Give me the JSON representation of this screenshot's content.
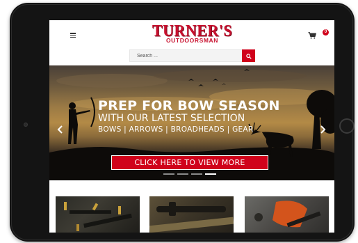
{
  "header": {
    "logo_top": "TURNER'S",
    "logo_bottom": "OUTDOORSMAN",
    "cart_count": "0"
  },
  "search": {
    "placeholder": "Search ..."
  },
  "hero": {
    "headline": "PREP FOR BOW SEASON",
    "subline": "WITH OUR LATEST SELECTION",
    "categories": "BOWS | ARROWS | BROADHEADS | GEAR",
    "cta_label": "CLICK HERE TO VIEW MORE",
    "slides_total": 4,
    "active_slide": 4
  },
  "colors": {
    "brand_red": "#c8102e",
    "button_red": "#d0021b",
    "device_frame": "#141414"
  },
  "icons": {
    "menu": "hamburger-menu-icon",
    "cart": "shopping-cart-icon",
    "search": "search-icon",
    "prev": "chevron-left-icon",
    "next": "chevron-right-icon"
  },
  "products": [
    {
      "name": "ammunition"
    },
    {
      "name": "rifle-scope"
    },
    {
      "name": "hunting-gear"
    }
  ]
}
